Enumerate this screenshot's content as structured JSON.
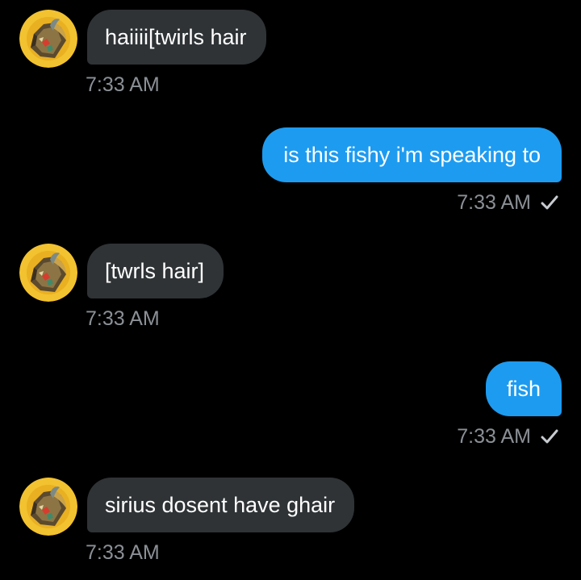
{
  "colors": {
    "background": "#000000",
    "incoming_bubble": "#2f3336",
    "outgoing_bubble": "#1d9bf0",
    "timestamp": "#8b9096",
    "avatar_ring": "#f2c230"
  },
  "messages": [
    {
      "direction": "incoming",
      "text": "haiiii[twirls hair",
      "time": "7:33 AM",
      "avatar_icon": "contact-avatar-icon"
    },
    {
      "direction": "outgoing",
      "text": "is this fishy i'm speaking to",
      "time": "7:33 AM",
      "status_icon": "sent-check-icon"
    },
    {
      "direction": "incoming",
      "text": "[twrls hair]",
      "time": "7:33 AM",
      "avatar_icon": "contact-avatar-icon"
    },
    {
      "direction": "outgoing",
      "text": "fish",
      "time": "7:33 AM",
      "status_icon": "sent-check-icon"
    },
    {
      "direction": "incoming",
      "text": "sirius dosent have ghair",
      "time": "7:33 AM",
      "avatar_icon": "contact-avatar-icon"
    }
  ]
}
